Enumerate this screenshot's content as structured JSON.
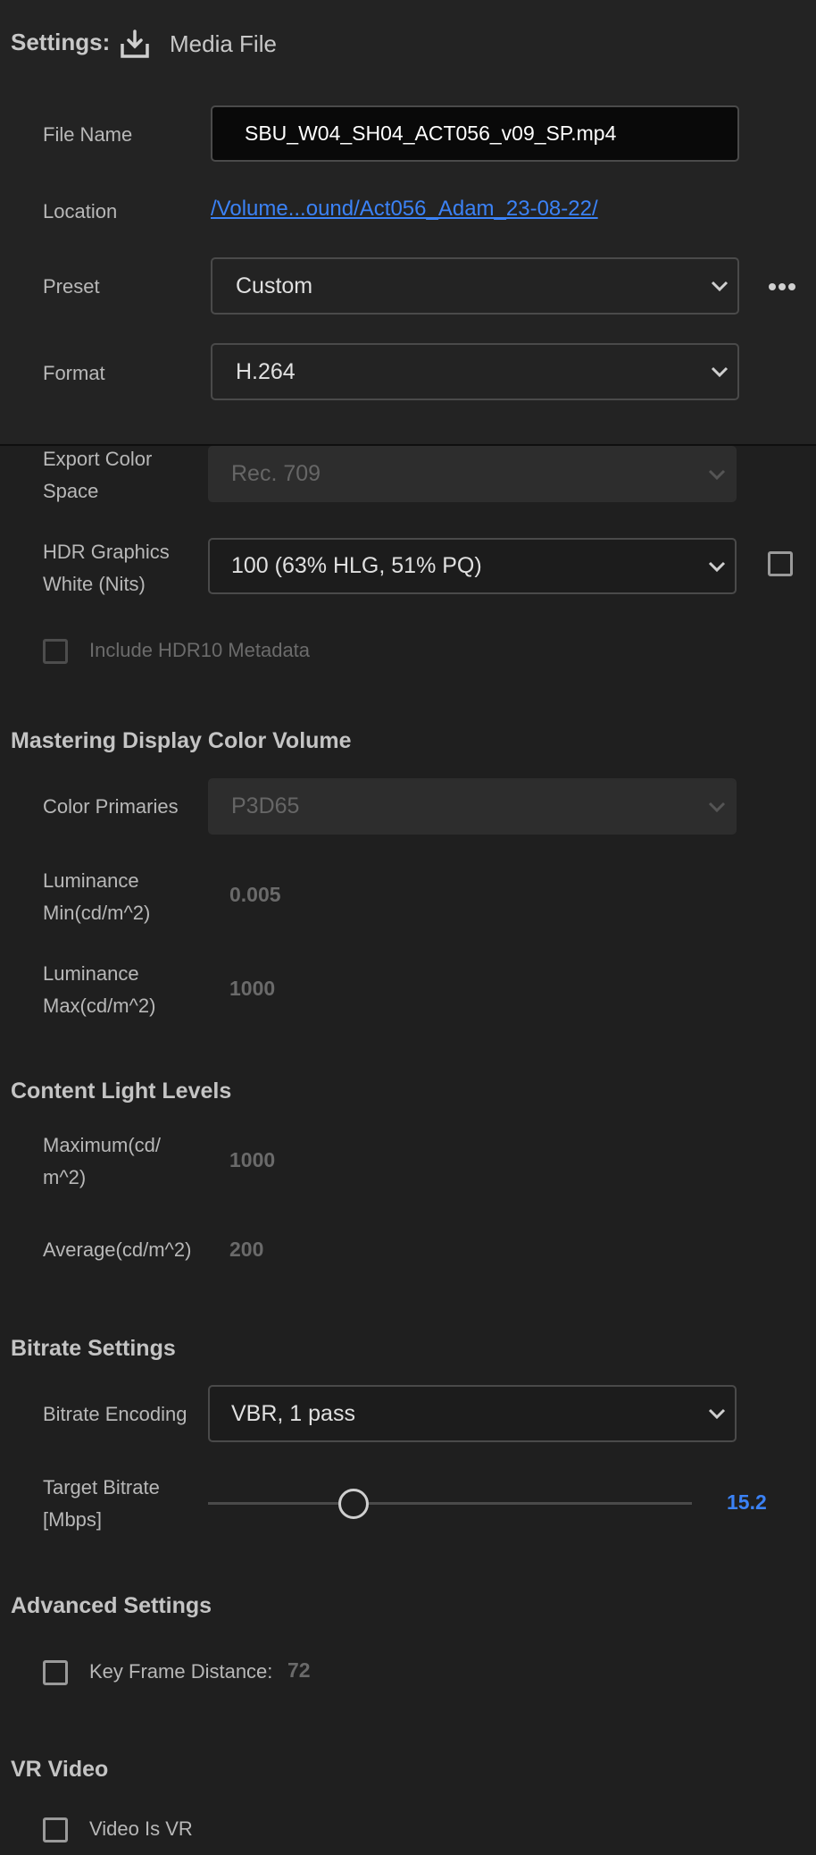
{
  "header": {
    "settings_label": "Settings:",
    "source_label": "Media File",
    "icon": "download-tray-icon"
  },
  "file_name": {
    "label": "File Name",
    "value": "SBU_W04_SH04_ACT056_v09_SP.mp4"
  },
  "location": {
    "label": "Location",
    "value": "/Volume...ound/Act056_Adam_23-08-22/"
  },
  "preset": {
    "label": "Preset",
    "value": "Custom",
    "more_icon": "more-horizontal-icon"
  },
  "format": {
    "label": "Format",
    "value": "H.264"
  },
  "export_color_space": {
    "label_line1": "Export Color",
    "label_line2": "Space",
    "value": "Rec. 709"
  },
  "hdr_graphics_white": {
    "label_line1": "HDR Graphics",
    "label_line2": "White (Nits)",
    "value": "100 (63% HLG, 51% PQ)"
  },
  "include_hdr10": {
    "label": "Include HDR10 Metadata",
    "checked": false
  },
  "mastering": {
    "title": "Mastering Display Color Volume",
    "color_primaries": {
      "label": "Color Primaries",
      "value": "P3D65"
    },
    "lum_min": {
      "label_line1": "Luminance",
      "label_line2": "Min(cd/m^2)",
      "value": "0.005"
    },
    "lum_max": {
      "label_line1": "Luminance",
      "label_line2": "Max(cd/m^2)",
      "value": "1000"
    }
  },
  "content_light": {
    "title": "Content Light Levels",
    "maximum": {
      "label_line1": "Maximum(cd/",
      "label_line2": "m^2)",
      "value": "1000"
    },
    "average": {
      "label": "Average(cd/m^2)",
      "value": "200"
    }
  },
  "bitrate": {
    "title": "Bitrate Settings",
    "encoding": {
      "label": "Bitrate Encoding",
      "value": "VBR, 1 pass"
    },
    "target": {
      "label_line1": "Target Bitrate",
      "label_line2": "[Mbps]",
      "value": "15.2",
      "slider_fraction": 0.3
    }
  },
  "advanced": {
    "title": "Advanced Settings",
    "key_frame": {
      "label": "Key Frame Distance:",
      "value": "72",
      "checked": false
    }
  },
  "vr": {
    "title": "VR Video",
    "video_is_vr": {
      "label": "Video Is VR",
      "checked": false
    }
  },
  "colors": {
    "accent": "#3b82f6",
    "background": "#1f1f1f",
    "header_bg": "#232323"
  }
}
